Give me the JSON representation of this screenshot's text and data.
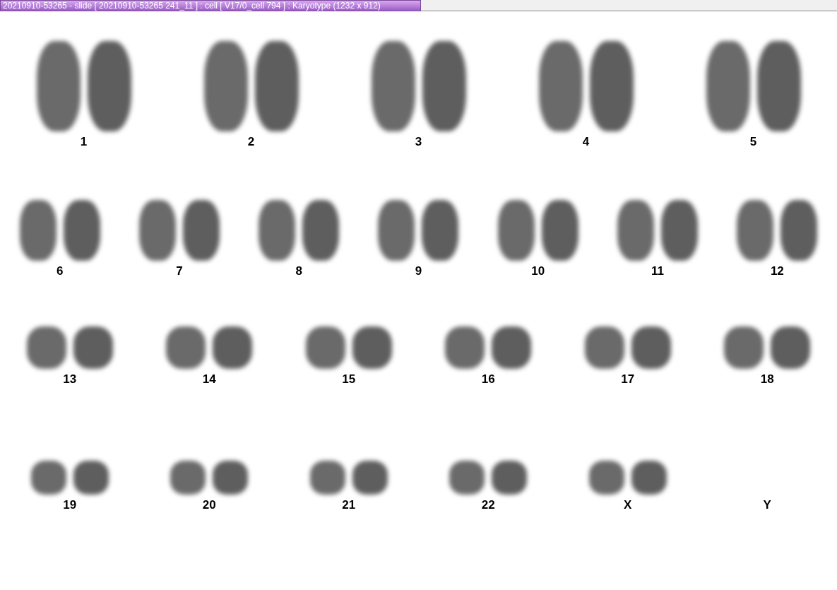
{
  "window": {
    "title": "20210910-53265 - slide [ 20210910-53265 241_11 ] : cell [ V17/0_cell 794 ] : Karyotype  (1232 x 912)"
  },
  "karyotype": {
    "rows": [
      {
        "items": [
          {
            "label": "1",
            "kind": "pair"
          },
          {
            "label": "2",
            "kind": "pair"
          },
          {
            "label": "3",
            "kind": "pair"
          },
          {
            "label": "4",
            "kind": "pair"
          },
          {
            "label": "5",
            "kind": "pair"
          }
        ]
      },
      {
        "items": [
          {
            "label": "6",
            "kind": "pair"
          },
          {
            "label": "7",
            "kind": "pair"
          },
          {
            "label": "8",
            "kind": "pair"
          },
          {
            "label": "9",
            "kind": "pair"
          },
          {
            "label": "10",
            "kind": "pair"
          },
          {
            "label": "11",
            "kind": "pair"
          },
          {
            "label": "12",
            "kind": "pair"
          }
        ]
      },
      {
        "items": [
          {
            "label": "13",
            "kind": "pair"
          },
          {
            "label": "14",
            "kind": "pair"
          },
          {
            "label": "15",
            "kind": "pair"
          },
          {
            "label": "16",
            "kind": "pair"
          },
          {
            "label": "17",
            "kind": "pair"
          },
          {
            "label": "18",
            "kind": "pair"
          }
        ]
      },
      {
        "items": [
          {
            "label": "19",
            "kind": "pair"
          },
          {
            "label": "20",
            "kind": "pair"
          },
          {
            "label": "21",
            "kind": "pair"
          },
          {
            "label": "22",
            "kind": "pair"
          },
          {
            "label": "X",
            "kind": "pair"
          },
          {
            "label": "Y",
            "kind": "empty"
          }
        ]
      }
    ]
  }
}
